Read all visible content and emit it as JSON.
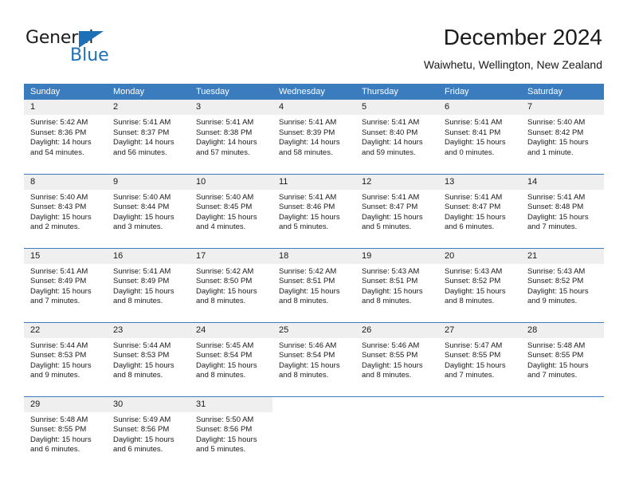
{
  "logo": {
    "word_top": "General",
    "word_bottom": "Blue",
    "triangle": "blue-triangle-icon",
    "color_blue": "#1d70b8",
    "color_dark": "#1b1b1b"
  },
  "header": {
    "title": "December 2024",
    "subtitle": "Waiwhetu, Wellington, New Zealand"
  },
  "theme": {
    "header_blue": "#3a7cbd",
    "daynum_gray": "#efefef",
    "text": "#1a1a1a"
  },
  "calendar": {
    "weekday_headers": [
      "Sunday",
      "Monday",
      "Tuesday",
      "Wednesday",
      "Thursday",
      "Friday",
      "Saturday"
    ],
    "weeks": [
      [
        {
          "date": "1",
          "sunrise": "Sunrise: 5:42 AM",
          "sunset": "Sunset: 8:36 PM",
          "daylight_1": "Daylight: 14 hours",
          "daylight_2": "and 54 minutes."
        },
        {
          "date": "2",
          "sunrise": "Sunrise: 5:41 AM",
          "sunset": "Sunset: 8:37 PM",
          "daylight_1": "Daylight: 14 hours",
          "daylight_2": "and 56 minutes."
        },
        {
          "date": "3",
          "sunrise": "Sunrise: 5:41 AM",
          "sunset": "Sunset: 8:38 PM",
          "daylight_1": "Daylight: 14 hours",
          "daylight_2": "and 57 minutes."
        },
        {
          "date": "4",
          "sunrise": "Sunrise: 5:41 AM",
          "sunset": "Sunset: 8:39 PM",
          "daylight_1": "Daylight: 14 hours",
          "daylight_2": "and 58 minutes."
        },
        {
          "date": "5",
          "sunrise": "Sunrise: 5:41 AM",
          "sunset": "Sunset: 8:40 PM",
          "daylight_1": "Daylight: 14 hours",
          "daylight_2": "and 59 minutes."
        },
        {
          "date": "6",
          "sunrise": "Sunrise: 5:41 AM",
          "sunset": "Sunset: 8:41 PM",
          "daylight_1": "Daylight: 15 hours",
          "daylight_2": "and 0 minutes."
        },
        {
          "date": "7",
          "sunrise": "Sunrise: 5:40 AM",
          "sunset": "Sunset: 8:42 PM",
          "daylight_1": "Daylight: 15 hours",
          "daylight_2": "and 1 minute."
        }
      ],
      [
        {
          "date": "8",
          "sunrise": "Sunrise: 5:40 AM",
          "sunset": "Sunset: 8:43 PM",
          "daylight_1": "Daylight: 15 hours",
          "daylight_2": "and 2 minutes."
        },
        {
          "date": "9",
          "sunrise": "Sunrise: 5:40 AM",
          "sunset": "Sunset: 8:44 PM",
          "daylight_1": "Daylight: 15 hours",
          "daylight_2": "and 3 minutes."
        },
        {
          "date": "10",
          "sunrise": "Sunrise: 5:40 AM",
          "sunset": "Sunset: 8:45 PM",
          "daylight_1": "Daylight: 15 hours",
          "daylight_2": "and 4 minutes."
        },
        {
          "date": "11",
          "sunrise": "Sunrise: 5:41 AM",
          "sunset": "Sunset: 8:46 PM",
          "daylight_1": "Daylight: 15 hours",
          "daylight_2": "and 5 minutes."
        },
        {
          "date": "12",
          "sunrise": "Sunrise: 5:41 AM",
          "sunset": "Sunset: 8:47 PM",
          "daylight_1": "Daylight: 15 hours",
          "daylight_2": "and 5 minutes."
        },
        {
          "date": "13",
          "sunrise": "Sunrise: 5:41 AM",
          "sunset": "Sunset: 8:47 PM",
          "daylight_1": "Daylight: 15 hours",
          "daylight_2": "and 6 minutes."
        },
        {
          "date": "14",
          "sunrise": "Sunrise: 5:41 AM",
          "sunset": "Sunset: 8:48 PM",
          "daylight_1": "Daylight: 15 hours",
          "daylight_2": "and 7 minutes."
        }
      ],
      [
        {
          "date": "15",
          "sunrise": "Sunrise: 5:41 AM",
          "sunset": "Sunset: 8:49 PM",
          "daylight_1": "Daylight: 15 hours",
          "daylight_2": "and 7 minutes."
        },
        {
          "date": "16",
          "sunrise": "Sunrise: 5:41 AM",
          "sunset": "Sunset: 8:49 PM",
          "daylight_1": "Daylight: 15 hours",
          "daylight_2": "and 8 minutes."
        },
        {
          "date": "17",
          "sunrise": "Sunrise: 5:42 AM",
          "sunset": "Sunset: 8:50 PM",
          "daylight_1": "Daylight: 15 hours",
          "daylight_2": "and 8 minutes."
        },
        {
          "date": "18",
          "sunrise": "Sunrise: 5:42 AM",
          "sunset": "Sunset: 8:51 PM",
          "daylight_1": "Daylight: 15 hours",
          "daylight_2": "and 8 minutes."
        },
        {
          "date": "19",
          "sunrise": "Sunrise: 5:43 AM",
          "sunset": "Sunset: 8:51 PM",
          "daylight_1": "Daylight: 15 hours",
          "daylight_2": "and 8 minutes."
        },
        {
          "date": "20",
          "sunrise": "Sunrise: 5:43 AM",
          "sunset": "Sunset: 8:52 PM",
          "daylight_1": "Daylight: 15 hours",
          "daylight_2": "and 8 minutes."
        },
        {
          "date": "21",
          "sunrise": "Sunrise: 5:43 AM",
          "sunset": "Sunset: 8:52 PM",
          "daylight_1": "Daylight: 15 hours",
          "daylight_2": "and 9 minutes."
        }
      ],
      [
        {
          "date": "22",
          "sunrise": "Sunrise: 5:44 AM",
          "sunset": "Sunset: 8:53 PM",
          "daylight_1": "Daylight: 15 hours",
          "daylight_2": "and 9 minutes."
        },
        {
          "date": "23",
          "sunrise": "Sunrise: 5:44 AM",
          "sunset": "Sunset: 8:53 PM",
          "daylight_1": "Daylight: 15 hours",
          "daylight_2": "and 8 minutes."
        },
        {
          "date": "24",
          "sunrise": "Sunrise: 5:45 AM",
          "sunset": "Sunset: 8:54 PM",
          "daylight_1": "Daylight: 15 hours",
          "daylight_2": "and 8 minutes."
        },
        {
          "date": "25",
          "sunrise": "Sunrise: 5:46 AM",
          "sunset": "Sunset: 8:54 PM",
          "daylight_1": "Daylight: 15 hours",
          "daylight_2": "and 8 minutes."
        },
        {
          "date": "26",
          "sunrise": "Sunrise: 5:46 AM",
          "sunset": "Sunset: 8:55 PM",
          "daylight_1": "Daylight: 15 hours",
          "daylight_2": "and 8 minutes."
        },
        {
          "date": "27",
          "sunrise": "Sunrise: 5:47 AM",
          "sunset": "Sunset: 8:55 PM",
          "daylight_1": "Daylight: 15 hours",
          "daylight_2": "and 7 minutes."
        },
        {
          "date": "28",
          "sunrise": "Sunrise: 5:48 AM",
          "sunset": "Sunset: 8:55 PM",
          "daylight_1": "Daylight: 15 hours",
          "daylight_2": "and 7 minutes."
        }
      ],
      [
        {
          "date": "29",
          "sunrise": "Sunrise: 5:48 AM",
          "sunset": "Sunset: 8:55 PM",
          "daylight_1": "Daylight: 15 hours",
          "daylight_2": "and 6 minutes."
        },
        {
          "date": "30",
          "sunrise": "Sunrise: 5:49 AM",
          "sunset": "Sunset: 8:56 PM",
          "daylight_1": "Daylight: 15 hours",
          "daylight_2": "and 6 minutes."
        },
        {
          "date": "31",
          "sunrise": "Sunrise: 5:50 AM",
          "sunset": "Sunset: 8:56 PM",
          "daylight_1": "Daylight: 15 hours",
          "daylight_2": "and 5 minutes."
        },
        null,
        null,
        null,
        null
      ]
    ]
  }
}
